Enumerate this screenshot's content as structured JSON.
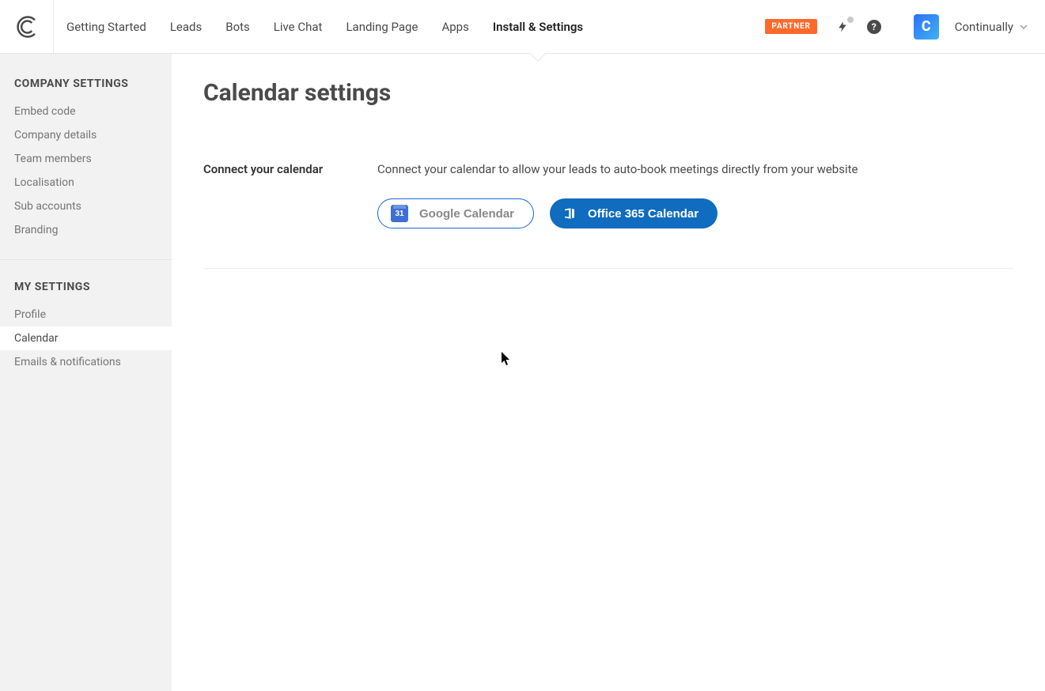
{
  "header": {
    "nav": [
      {
        "label": "Getting Started",
        "active": false
      },
      {
        "label": "Leads",
        "active": false
      },
      {
        "label": "Bots",
        "active": false
      },
      {
        "label": "Live Chat",
        "active": false
      },
      {
        "label": "Landing Page",
        "active": false
      },
      {
        "label": "Apps",
        "active": false
      },
      {
        "label": "Install & Settings",
        "active": true
      }
    ],
    "partner_badge": "PARTNER",
    "account_name": "Continually",
    "avatar_letter": "C"
  },
  "sidebar": {
    "company_heading": "COMPANY SETTINGS",
    "company_items": [
      {
        "label": "Embed code",
        "active": false
      },
      {
        "label": "Company details",
        "active": false
      },
      {
        "label": "Team members",
        "active": false
      },
      {
        "label": "Localisation",
        "active": false
      },
      {
        "label": "Sub accounts",
        "active": false
      },
      {
        "label": "Branding",
        "active": false
      }
    ],
    "my_heading": "MY SETTINGS",
    "my_items": [
      {
        "label": "Profile",
        "active": false
      },
      {
        "label": "Calendar",
        "active": true
      },
      {
        "label": "Emails & notifications",
        "active": false
      }
    ]
  },
  "main": {
    "page_title": "Calendar settings",
    "section_label": "Connect your calendar",
    "section_text": "Connect your calendar to allow your leads to auto-book meetings directly from your website",
    "google_button": "Google Calendar",
    "gcal_day": "31",
    "office_button": "Office 365 Calendar"
  }
}
